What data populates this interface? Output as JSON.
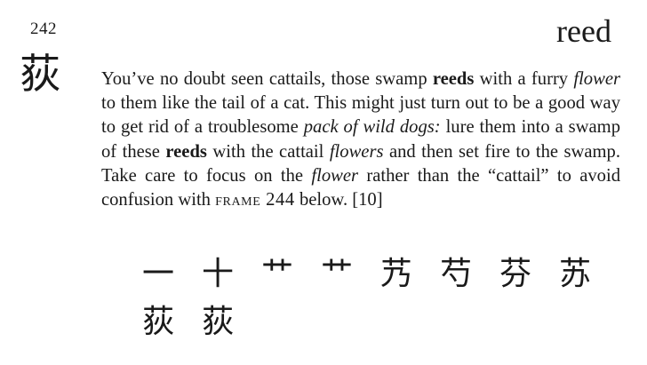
{
  "frame": {
    "number": "242",
    "keyword": "reed",
    "character": "荻"
  },
  "story": {
    "s1": "You’ve no doubt seen cattails, those swamp ",
    "s2": "reeds",
    "s3": " with a furry ",
    "s4": "flower",
    "s5": " to them like the tail of a cat. This might just turn out to be a good way to get rid of a troublesome ",
    "s6": "pack of wild dogs:",
    "s7": " lure them into a swamp of these ",
    "s8": "reeds",
    "s9": " with the cattail ",
    "s10": "flowers",
    "s11": " and then set fire to the swamp. Take care to focus on the ",
    "s12": "flower",
    "s13": " rather than the “cattail” to avoid confusion with ",
    "s14": "frame 244",
    "s15": " below. [10]"
  },
  "stroke_order": [
    "一",
    "十",
    "艹",
    "艹",
    "艿",
    "芍",
    "芬",
    "苏",
    "荻",
    "荻"
  ]
}
